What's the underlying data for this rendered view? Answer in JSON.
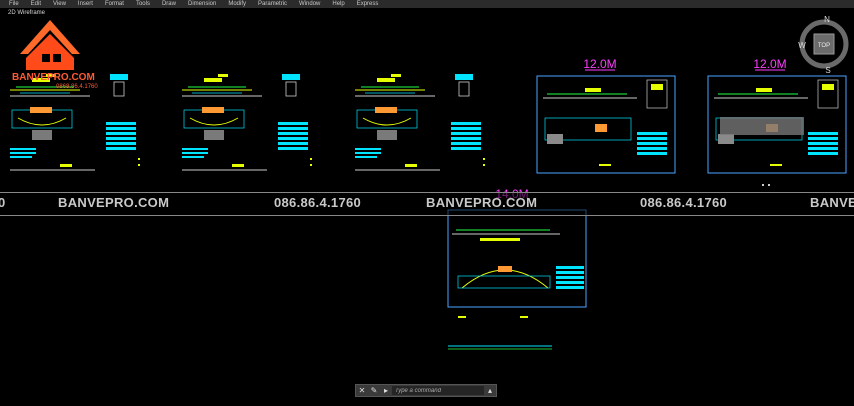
{
  "menu": [
    "File",
    "Edit",
    "View",
    "Insert",
    "Format",
    "Tools",
    "Draw",
    "Dimension",
    "Modify",
    "Parametric",
    "Window",
    "Help",
    "Express"
  ],
  "viewport_label": "2D Wireframe",
  "logo": {
    "brand": "BANVEPRO.COM",
    "phone": "0868.86.4.1760"
  },
  "sheet_titles": [
    "12.0M",
    "12.0M",
    "14.0M"
  ],
  "watermark": {
    "left_edge": "0",
    "site": "BANVEPRO.COM",
    "phone": "086.86.4.1760",
    "right_edge": "BANVE"
  },
  "navcube": {
    "n": "N",
    "s": "S",
    "w": "W",
    "top": "TOP"
  },
  "command": {
    "placeholder": "Type a command"
  },
  "colors": {
    "accent": "#ff3dff",
    "frame": "#4aa3ff",
    "lines": "#e6ff00",
    "cyan": "#00e5ff",
    "green": "#22ff44"
  }
}
